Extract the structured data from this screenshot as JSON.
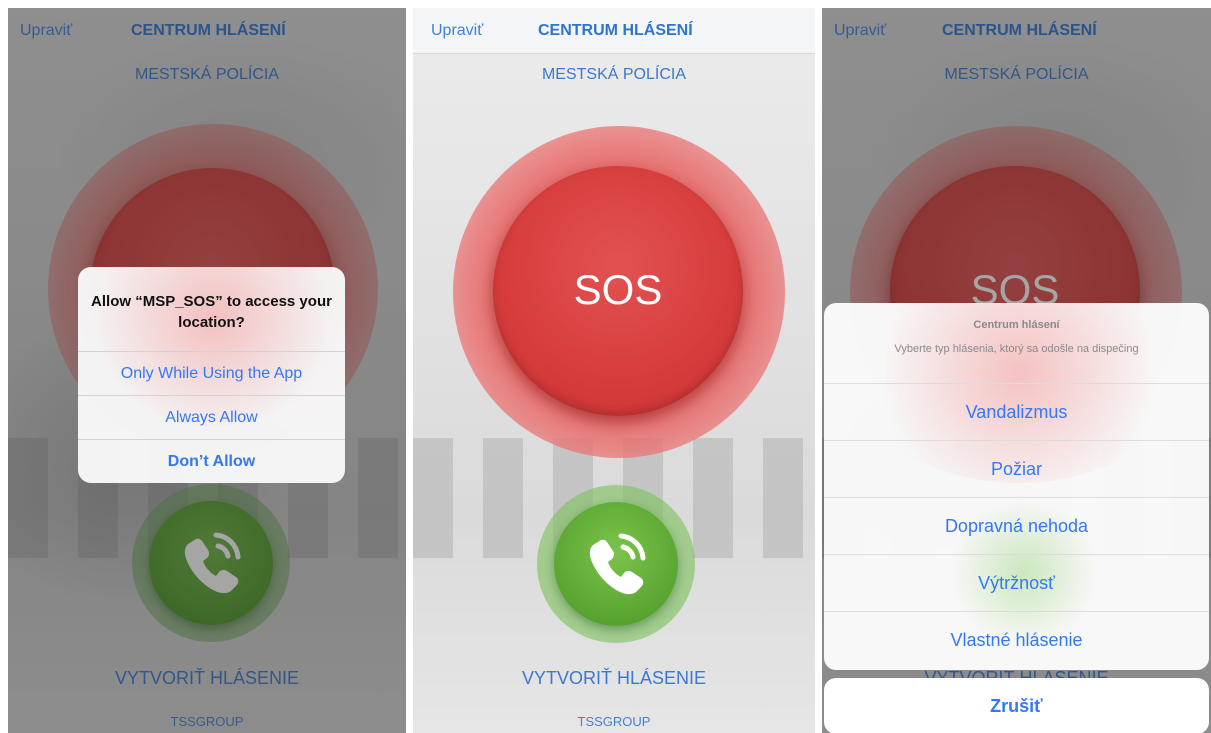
{
  "common": {
    "nav_left": "Upraviť",
    "nav_title": "CENTRUM HLÁSENÍ",
    "subtitle": "MESTSKÁ POLÍCIA",
    "sos_label": "SOS",
    "cta": "VYTVORIŤ HLÁSENIE",
    "footer": "TSSGROUP"
  },
  "screen1": {
    "alert": {
      "title": "Allow “MSP_SOS” to access your location?",
      "buttons": [
        "Only While Using the App",
        "Always Allow",
        "Don’t Allow"
      ]
    }
  },
  "screen3": {
    "sheet": {
      "title": "Centrum hlásení",
      "message": "Vyberte typ hlásenia, ktorý sa odošle na dispečing",
      "items": [
        "Vandalizmus",
        "Požiar",
        "Dopravná nehoda",
        "Výtržnosť",
        "Vlastné hlásenie"
      ],
      "cancel": "Zrušiť"
    }
  },
  "colors": {
    "accent": "#3478f6",
    "sos_red": "#d63c3c",
    "call_green": "#4f9a2a"
  }
}
